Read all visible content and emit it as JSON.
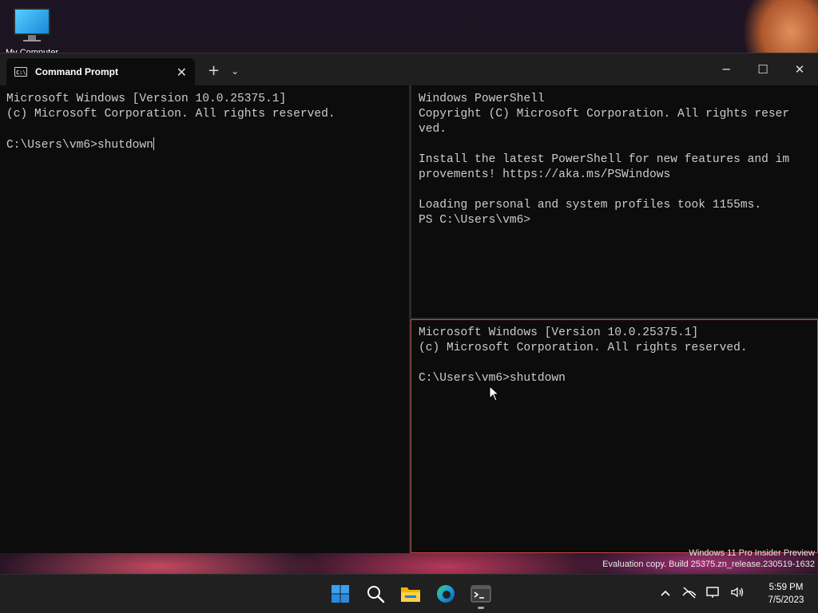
{
  "desktop": {
    "icon_label": "My Computer"
  },
  "window": {
    "tab_title": "Command Prompt",
    "tab_icon_text": "C:\\",
    "new_tab_symbol": "+",
    "dropdown_symbol": "⌄",
    "close_tab_symbol": "✕",
    "minimize_symbol": "─",
    "maximize_symbol": "☐",
    "close_symbol": "✕"
  },
  "panes": {
    "left": {
      "lines": [
        "Microsoft Windows [Version 10.0.25375.1]",
        "(c) Microsoft Corporation. All rights reserved.",
        "",
        "C:\\Users\\vm6>shutdown"
      ]
    },
    "right_top": {
      "lines": [
        "Windows PowerShell",
        "Copyright (C) Microsoft Corporation. All rights reser",
        "ved.",
        "",
        "Install the latest PowerShell for new features and im",
        "provements! https://aka.ms/PSWindows",
        "",
        "Loading personal and system profiles took 1155ms.",
        "PS C:\\Users\\vm6>"
      ]
    },
    "right_bottom": {
      "lines": [
        "Microsoft Windows [Version 10.0.25375.1]",
        "(c) Microsoft Corporation. All rights reserved.",
        "",
        "C:\\Users\\vm6>shutdown"
      ]
    }
  },
  "watermark": {
    "line1": "Windows 11 Pro Insider Preview",
    "line2": "Evaluation copy. Build 25375.zn_release.230519-1632"
  },
  "taskbar": {
    "time": "5:59 PM",
    "date": "7/5/2023",
    "apps": [
      "start-icon",
      "search-icon",
      "file-explorer-icon",
      "edge-icon",
      "terminal-icon"
    ],
    "tray": [
      "chevron-up-icon",
      "network-offline-icon",
      "display-icon",
      "volume-icon"
    ]
  },
  "colors": {
    "active_pane_border": "#d0453a",
    "terminal_bg": "#0c0c0c",
    "terminal_fg": "#cccccc",
    "taskbar_bg": "#202020"
  }
}
